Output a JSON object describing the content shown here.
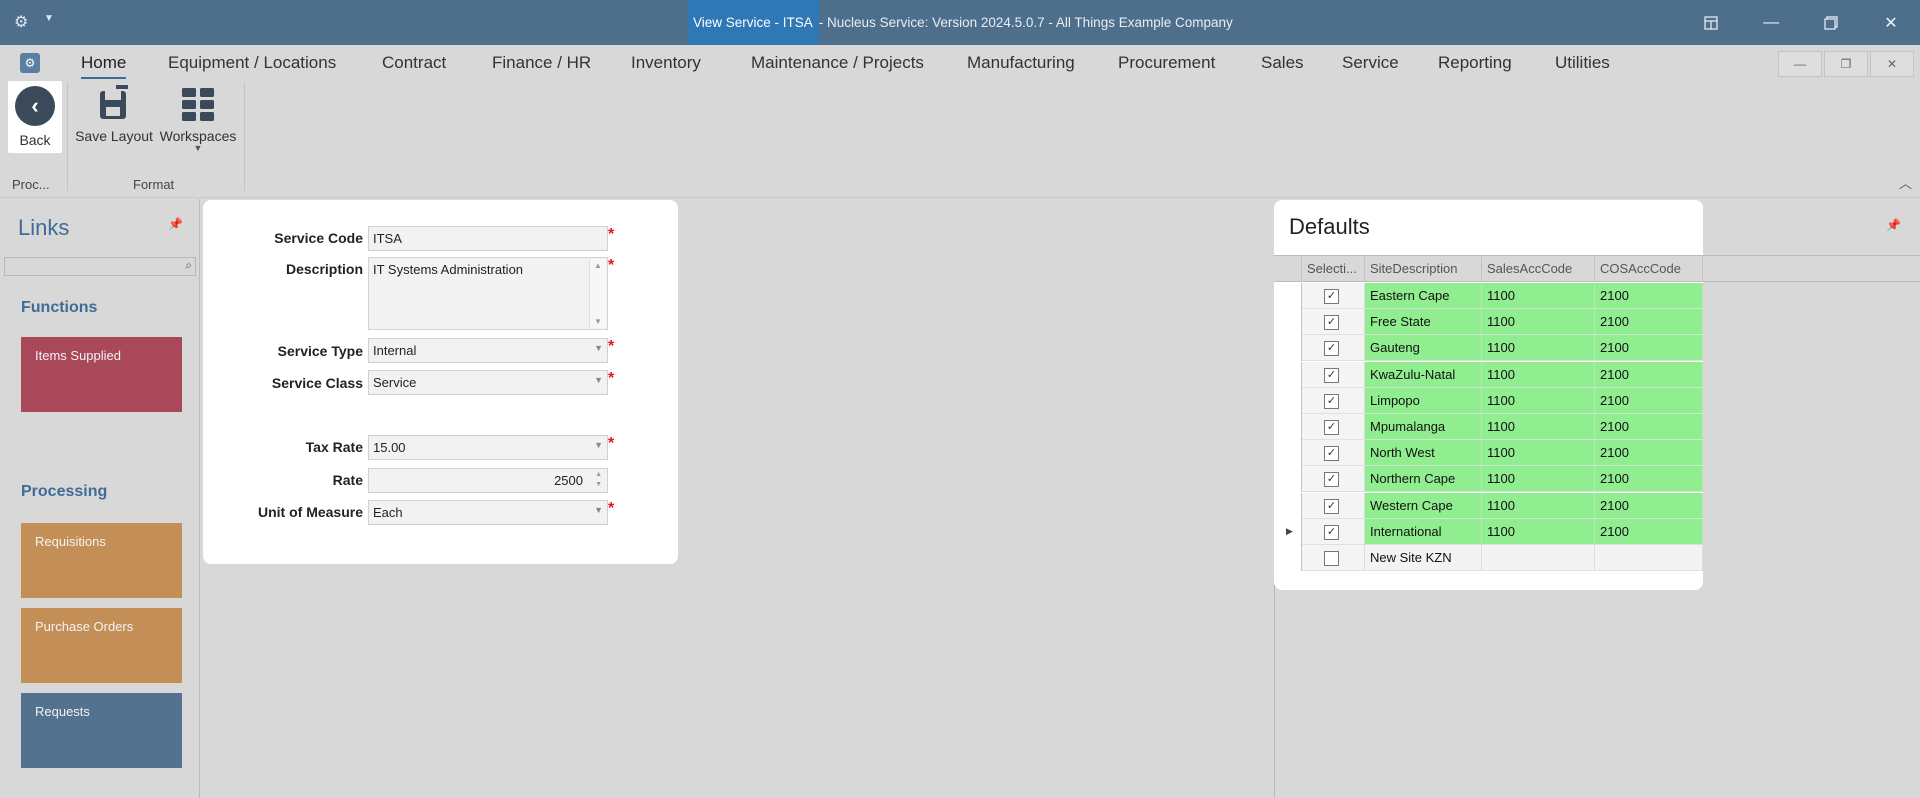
{
  "titlebar": {
    "highlight": "View Service - ITSA",
    "rest": " - Nucleus Service: Version 2024.5.0.7 - All Things Example Company"
  },
  "tabs": [
    "Home",
    "Equipment / Locations",
    "Contract",
    "Finance / HR",
    "Inventory",
    "Maintenance / Projects",
    "Manufacturing",
    "Procurement",
    "Sales",
    "Service",
    "Reporting",
    "Utilities"
  ],
  "ribbon": {
    "back": "Back",
    "save_layout": "Save Layout",
    "workspaces": "Workspaces",
    "group_process": "Proc...",
    "group_format": "Format"
  },
  "links": {
    "title": "Links",
    "functions_heading": "Functions",
    "items_supplied": "Items Supplied",
    "processing_heading": "Processing",
    "requisitions": "Requisitions",
    "purchase_orders": "Purchase Orders",
    "requests": "Requests"
  },
  "form": {
    "service_code_label": "Service Code",
    "service_code": "ITSA",
    "description_label": "Description",
    "description": "IT Systems Administration",
    "service_type_label": "Service Type",
    "service_type": "Internal",
    "service_class_label": "Service Class",
    "service_class": "Service",
    "tax_rate_label": "Tax Rate",
    "tax_rate": "15.00",
    "rate_label": "Rate",
    "rate": "2500",
    "uom_label": "Unit of Measure",
    "uom": "Each",
    "required_mark": "*"
  },
  "defaults": {
    "title": "Defaults",
    "columns": [
      "Selecti...",
      "SiteDescription",
      "SalesAccCode",
      "COSAccCode"
    ],
    "rows": [
      {
        "site": "Eastern Cape",
        "sales": "1100",
        "cos": "2100"
      },
      {
        "site": "Free State",
        "sales": "1100",
        "cos": "2100"
      },
      {
        "site": "Gauteng",
        "sales": "1100",
        "cos": "2100"
      },
      {
        "site": "KwaZulu-Natal",
        "sales": "1100",
        "cos": "2100"
      },
      {
        "site": "Limpopo",
        "sales": "1100",
        "cos": "2100"
      },
      {
        "site": "Mpumalanga",
        "sales": "1100",
        "cos": "2100"
      },
      {
        "site": "North West",
        "sales": "1100",
        "cos": "2100"
      },
      {
        "site": "Northern Cape",
        "sales": "1100",
        "cos": "2100"
      },
      {
        "site": "Western Cape",
        "sales": "1100",
        "cos": "2100"
      },
      {
        "site": "International",
        "sales": "1100",
        "cos": "2100"
      }
    ],
    "new_row_site": "New Site KZN",
    "row_color": "#90ee90"
  }
}
